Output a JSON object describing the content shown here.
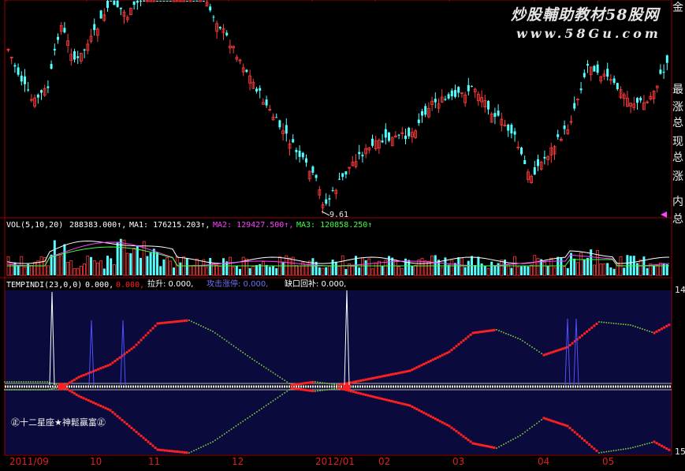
{
  "watermark": {
    "line1": "炒股輔助教材58股网",
    "line2": "www.58Gu.com"
  },
  "price_panel": {
    "low_marker": "9.61"
  },
  "volume_panel": {
    "indicator": "VOL(5,10,20)",
    "vol_value": "288383.000↑,",
    "ma1": "MA1: 176215.203↑,",
    "ma2": "MA2: 129427.500↑,",
    "ma3": "MA3: 120858.250↑",
    "colors": {
      "vol": "#ffffff",
      "ma1": "#ffffff",
      "ma2": "#ff40ff",
      "ma3": "#40ff40"
    }
  },
  "indicator_panel": {
    "title": "TEMPINDI(23,0,0)",
    "v1": "0.000,",
    "v2": "0.000,",
    "lift": "拉升: 0.000,",
    "limit_up": "攻击涨停: 0.000,",
    "gap": "缺口回补: 0.000,",
    "badge": "㊣十二星座★神鬆贏富㊣",
    "right_top": "14",
    "right_bottom": "15"
  },
  "side_labels": [
    "最",
    "涨",
    "总",
    "现",
    "总",
    "涨",
    "内",
    "总"
  ],
  "side_top_char": "金",
  "x_axis": [
    "2011/09",
    "10",
    "11",
    "12",
    "2012/01",
    "02",
    "03",
    "04",
    "05"
  ],
  "colors": {
    "up": "#ff3c3c",
    "down": "#54ffff",
    "grid": "#9a0000",
    "panel_bg": "#0a0a3c",
    "line_red": "#ff2020",
    "line_green": "#7cd23c",
    "spike_white": "#ffffff",
    "spike_blue": "#5050ff"
  }
}
